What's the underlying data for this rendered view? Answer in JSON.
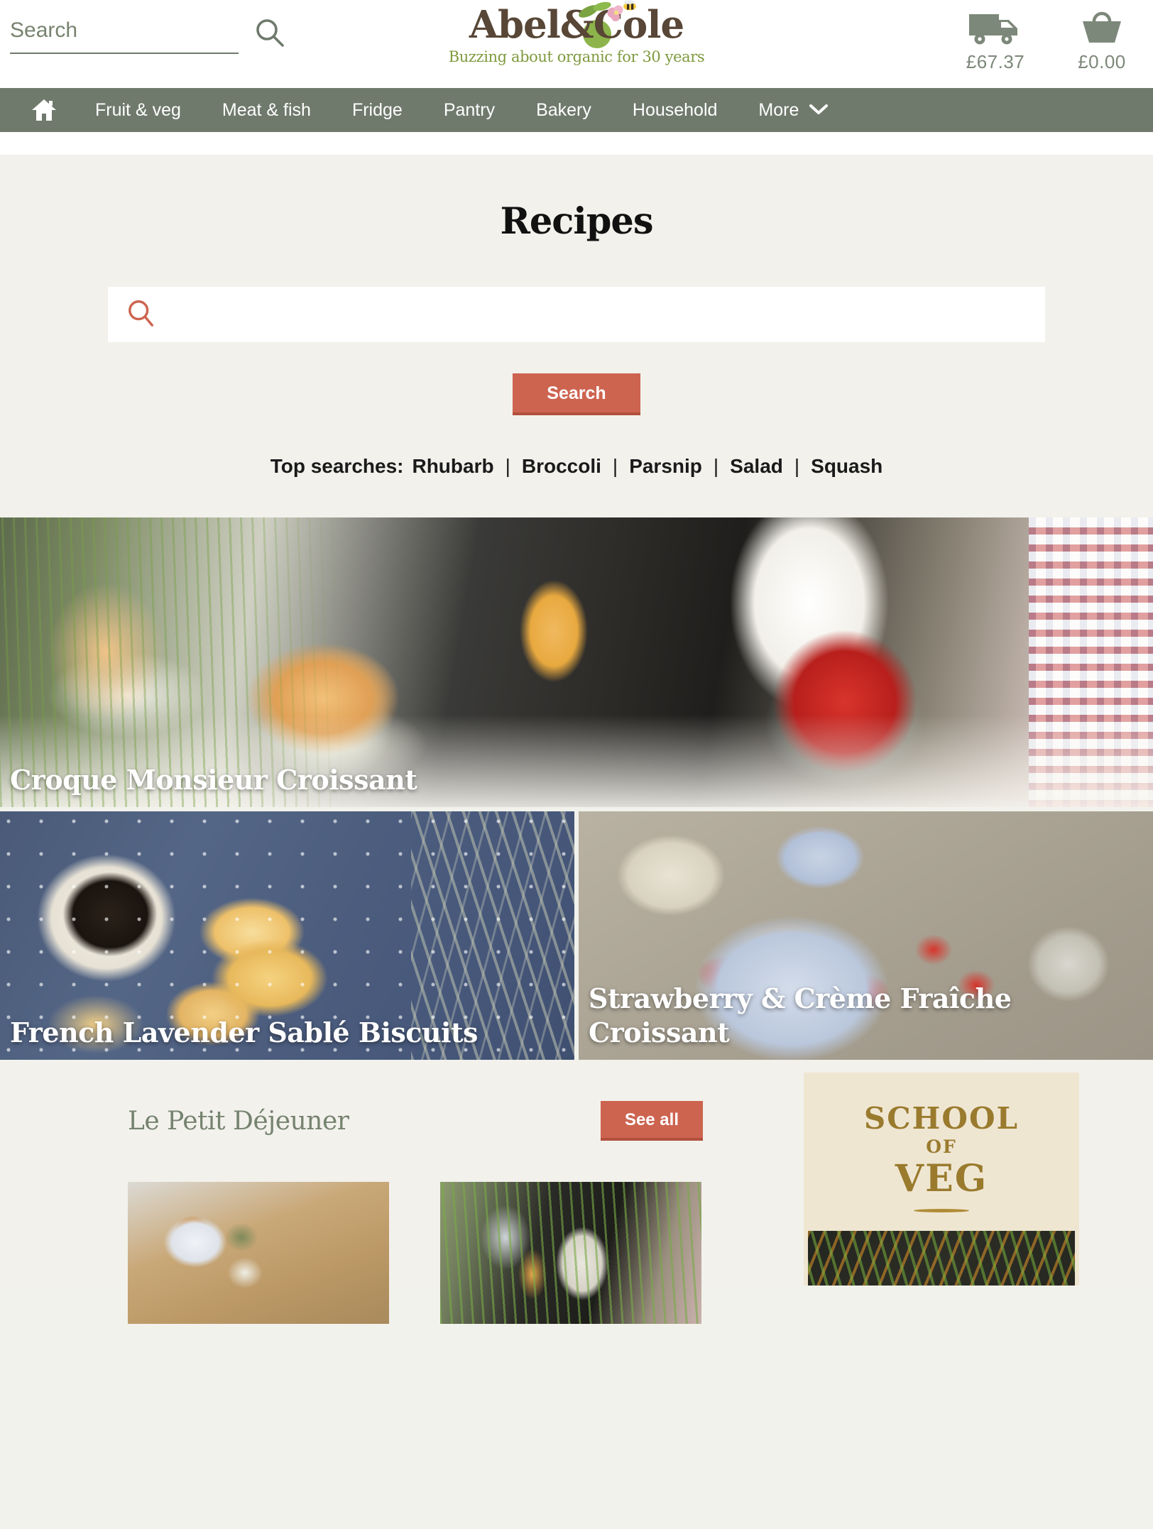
{
  "header": {
    "search_placeholder": "Search",
    "search_value": "",
    "search_icon": "search-icon",
    "logo": {
      "brand_part1": "Abel",
      "brand_amp": "&",
      "brand_part2": "Cole",
      "tagline": "Buzzing about organic for 30 years",
      "apple_color": "#8cb44a",
      "brand_color": "#584636",
      "tagline_color": "#7e9a3e"
    },
    "delivery": {
      "icon": "delivery-truck-icon",
      "amount": "£67.37"
    },
    "basket": {
      "icon": "shopping-basket-icon",
      "amount": "£0.00"
    }
  },
  "nav": {
    "background": "#6f7a6c",
    "home_icon": "home-icon",
    "items": [
      {
        "label": "Fruit & veg"
      },
      {
        "label": "Meat & fish"
      },
      {
        "label": "Fridge"
      },
      {
        "label": "Pantry"
      },
      {
        "label": "Bakery"
      },
      {
        "label": "Household"
      },
      {
        "label": "More",
        "icon": "chevron-down-icon"
      }
    ]
  },
  "recipes": {
    "title": "Recipes",
    "search": {
      "icon": "search-icon",
      "icon_color": "#cd6450",
      "value": "",
      "placeholder": "",
      "button_label": "Search",
      "button_color": "#cd6450"
    },
    "top_searches": {
      "label": "Top searches:",
      "separator": "|",
      "items": [
        "Rhubarb",
        "Broccoli",
        "Parsnip",
        "Salad",
        "Squash"
      ]
    }
  },
  "tiles": {
    "hero": {
      "caption": "Croque Monsieur Croissant"
    },
    "left": {
      "caption": "French Lavender Sablé Biscuits"
    },
    "right": {
      "caption": "Strawberry & Crème Fraîche Croissant"
    }
  },
  "bottom": {
    "section_title": "Le Petit Déjeuner",
    "see_all_label": "See all",
    "cards": [
      {
        "name": "breakfast-card-1"
      },
      {
        "name": "breakfast-card-2"
      }
    ],
    "school_of_veg": {
      "line1": "SCHOOL",
      "line2": "OF",
      "line3": "VEG",
      "background": "#efe6d2",
      "text_color": "#9a7b2e"
    }
  }
}
